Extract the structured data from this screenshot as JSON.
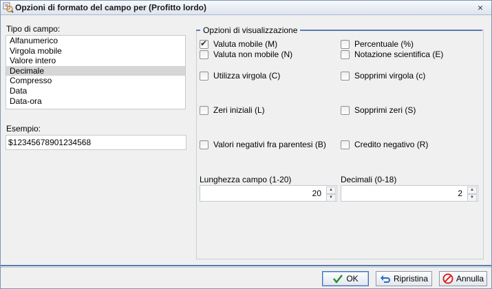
{
  "window": {
    "title": "Opzioni di formato del campo per (Profitto lordo)",
    "close_glyph": "×"
  },
  "left": {
    "field_type_label": "Tipo di campo:",
    "field_types": [
      "Alfanumerico",
      "Virgola mobile",
      "Valore intero",
      "Decimale",
      "Compresso",
      "Data",
      "Data-ora"
    ],
    "selected_field_type": "Decimale",
    "example_label": "Esempio:",
    "example_value": "$12345678901234568"
  },
  "display_options": {
    "legend": "Opzioni di visualizzazione",
    "checkboxes": {
      "floating_currency": {
        "label": "Valuta mobile (M)",
        "checked": true
      },
      "percentage": {
        "label": "Percentuale (%)",
        "checked": false
      },
      "non_floating_currency": {
        "label": "Valuta non mobile (N)",
        "checked": false
      },
      "scientific_notation": {
        "label": "Notazione scientifica (E)",
        "checked": false
      },
      "use_comma": {
        "label": "Utilizza virgola (C)",
        "checked": false
      },
      "suppress_comma": {
        "label": "Sopprimi virgola (c)",
        "checked": false
      },
      "leading_zeros": {
        "label": "Zeri iniziali (L)",
        "checked": false
      },
      "suppress_zeros": {
        "label": "Sopprimi zeri (S)",
        "checked": false
      },
      "negative_parentheses": {
        "label": "Valori negativi fra parentesi (B)",
        "checked": false
      },
      "credit_negative": {
        "label": "Credito negativo (R)",
        "checked": false
      }
    },
    "field_length_label": "Lunghezza campo (1-20)",
    "field_length_value": "20",
    "decimals_label": "Decimali (0-18)",
    "decimals_value": "2"
  },
  "footer": {
    "ok_label": "OK",
    "reset_label": "Ripristina",
    "cancel_label": "Annulla"
  }
}
